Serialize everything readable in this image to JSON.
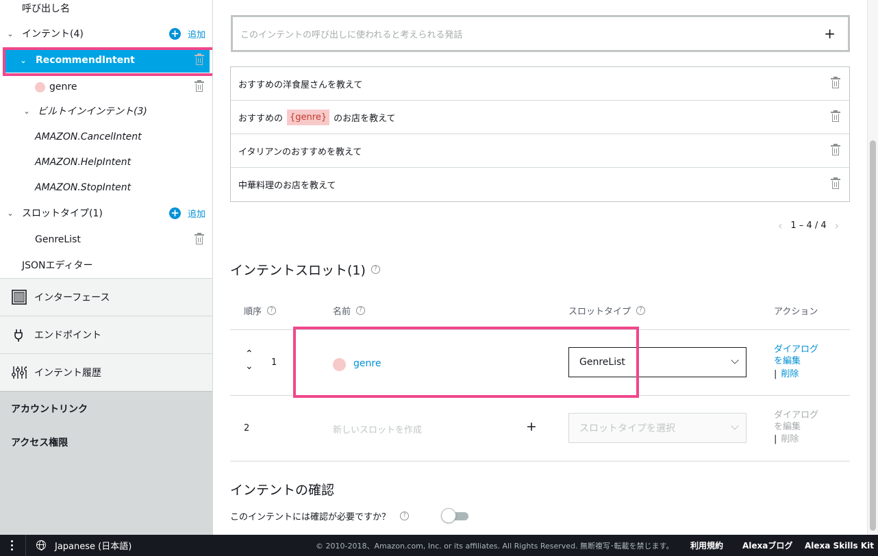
{
  "sidebar": {
    "invocation_name": "呼び出し名",
    "intents_header": "インテント(4)",
    "add_label": "追加",
    "selected_intent": "RecommendIntent",
    "slot_item": "genre",
    "builtin_header": "ビルトインインテント(3)",
    "builtin_intents": [
      "AMAZON.CancelIntent",
      "AMAZON.HelpIntent",
      "AMAZON.StopIntent"
    ],
    "slot_types_header": "スロットタイプ(1)",
    "slot_type_item": "GenreList",
    "json_editor": "JSONエディター",
    "nav": [
      {
        "label": "インターフェース",
        "icon": "interface-grid-icon"
      },
      {
        "label": "エンドポイント",
        "icon": "endpoint-plug-icon"
      },
      {
        "label": "インテント履歴",
        "icon": "history-sliders-icon"
      }
    ],
    "account_link": "アカウントリンク",
    "permissions": "アクセス権限"
  },
  "utterances": {
    "input_placeholder": "このインテントの呼び出しに使われると考えられる発話",
    "items": [
      {
        "before": "おすすめの洋食屋さんを教えて",
        "slot": "",
        "after": ""
      },
      {
        "before": "おすすめの",
        "slot": "{genre}",
        "after": "のお店を教えて"
      },
      {
        "before": "イタリアンのおすすめを教えて",
        "slot": "",
        "after": ""
      },
      {
        "before": "中華料理のお店を教えて",
        "slot": "",
        "after": ""
      }
    ],
    "pagination": "1 – 4 / 4"
  },
  "slots": {
    "title": "インテントスロット(1)",
    "columns": {
      "order": "順序",
      "name": "名前",
      "slot_type": "スロットタイプ",
      "action": "アクション"
    },
    "rows": [
      {
        "order": "1",
        "name": "genre",
        "slot_type": "GenreList",
        "edit_dialog_1": "ダイアログ",
        "edit_dialog_2": "を編集",
        "delete": "削除"
      },
      {
        "order": "2",
        "name_placeholder": "新しいスロットを作成",
        "slot_type_placeholder": "スロットタイプを選択",
        "edit_dialog_1": "ダイアログ",
        "edit_dialog_2": "を編集",
        "delete": "削除"
      }
    ]
  },
  "confirmation": {
    "title": "インテントの確認",
    "question": "このインテントには確認が必要ですか？",
    "enabled": false
  },
  "footer": {
    "language": "Japanese (日本語)",
    "copyright": "© 2010-2018、Amazon.com, Inc. or its affiliates. All Rights Reserved. 無断複写･転載を禁じます。",
    "links": [
      "利用規約",
      "Alexaブログ",
      "Alexa Skills Kit"
    ]
  },
  "colors": {
    "accent": "#00a4e4",
    "link": "#0091d5",
    "highlight": "#f0478c",
    "slot_chip": "#f8c9c9"
  }
}
